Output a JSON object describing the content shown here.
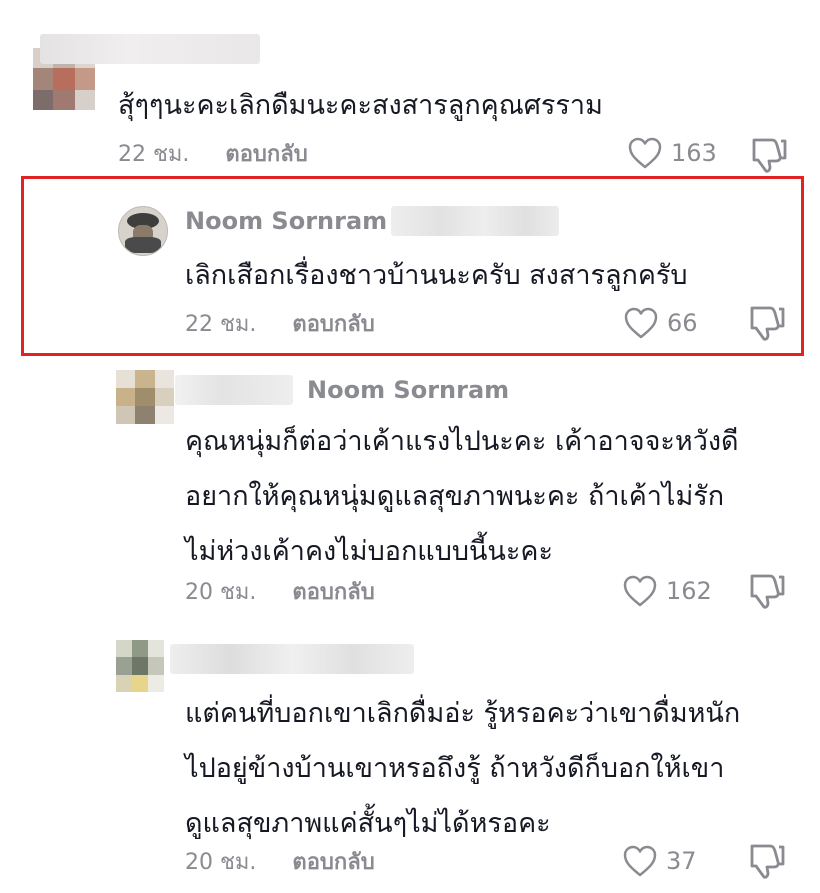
{
  "comments": [
    {
      "username": "",
      "text_lines": [
        "สุ้ๆๆนะคะเลิกดืมนะคะสงสารลูกคุณศรราม"
      ],
      "time": "22 ชม.",
      "reply_label": "ตอบกลับ",
      "likes": "163"
    },
    {
      "username": "Noom Sornram",
      "text_lines": [
        "เลิกเสือกเรื่องชาวบ้านนะครับ สงสารลูกครับ"
      ],
      "time": "22 ชม.",
      "reply_label": "ตอบกลับ",
      "likes": "66"
    },
    {
      "username": "Noom Sornram",
      "text_lines": [
        "คุณหนุ่มก็ต่อว่าเค้าแรงไปนะคะ เค้าอาจจะหวังดี",
        "อยากให้คุณหนุ่มดูแลสุขภาพนะคะ ถ้าเค้าไม่รัก",
        "ไม่ห่วงเค้าคงไม่บอกแบบนี้นะคะ"
      ],
      "time": "20 ชม.",
      "reply_label": "ตอบกลับ",
      "likes": "162"
    },
    {
      "username": "",
      "text_lines": [
        "แต่คนที่บอกเขาเลิกดื่มอ่ะ รู้หรอคะว่าเขาดื่มหนัก",
        "ไปอยู่ข้างบ้านเขาหรอถึงรู้ ถ้าหวังดีก็บอกให้เขา",
        "ดูแลสุขภาพแค่สั้นๆไม่ได้หรอคะ"
      ],
      "time": "20 ชม.",
      "reply_label": "ตอบกลับ",
      "likes": "37"
    }
  ],
  "icons": {
    "like": "heart-outline-icon",
    "dislike": "thumbs-down-icon"
  },
  "colors": {
    "highlight": "#e02424",
    "muted": "#8a8b91",
    "text": "#161823"
  }
}
